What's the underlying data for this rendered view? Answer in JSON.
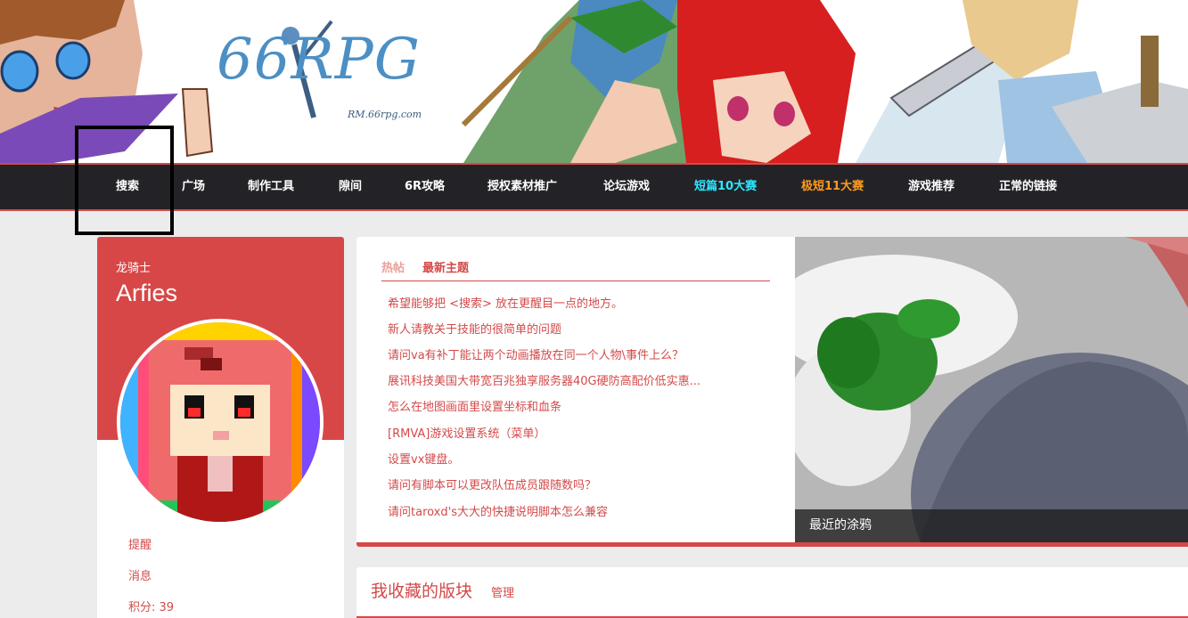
{
  "banner": {
    "logo_text": "66RPG",
    "logo_url_text": "RM.66rpg.com"
  },
  "nav": {
    "items": [
      {
        "label": "搜索"
      },
      {
        "label": "广场"
      },
      {
        "label": "制作工具"
      },
      {
        "label": "隙间"
      },
      {
        "label": "6R攻略"
      },
      {
        "label": "授权素材推广"
      },
      {
        "label": "论坛游戏"
      },
      {
        "label": "短篇10大赛",
        "color": "#2fe6ff"
      },
      {
        "label": "极短11大赛",
        "color": "#ff9a1e"
      },
      {
        "label": "游戏推荐"
      },
      {
        "label": "正常的链接"
      }
    ]
  },
  "profile": {
    "title": "龙骑士",
    "name": "Arfies",
    "links": {
      "reminders": "提醒",
      "messages": "消息",
      "points": "积分: 39"
    }
  },
  "posts": {
    "tabs": {
      "hot": "热帖",
      "latest": "最新主题"
    },
    "items": [
      "希望能够把 <搜索> 放在更醒目一点的地方。",
      "新人请教关于技能的很简单的问题",
      "请问va有补丁能让两个动画播放在同一个人物\\事件上么？",
      "展讯科技美国大带宽百兆独享服务器40G硬防高配价低实惠...",
      "怎么在地图画面里设置坐标和血条",
      "[RMVA]游戏设置系统（菜单）",
      "设置vx键盘。",
      "请问有脚本可以更改队伍成员跟随数吗？",
      "请问taroxd's大大的快捷说明脚本怎么兼容"
    ]
  },
  "doodle": {
    "caption": "最近的涂鸦"
  },
  "favorites": {
    "title": "我收藏的版块",
    "manage": "管理"
  },
  "colors": {
    "accent": "#d34a49",
    "nav_bg": "#232327",
    "page_bg": "#ececec"
  }
}
